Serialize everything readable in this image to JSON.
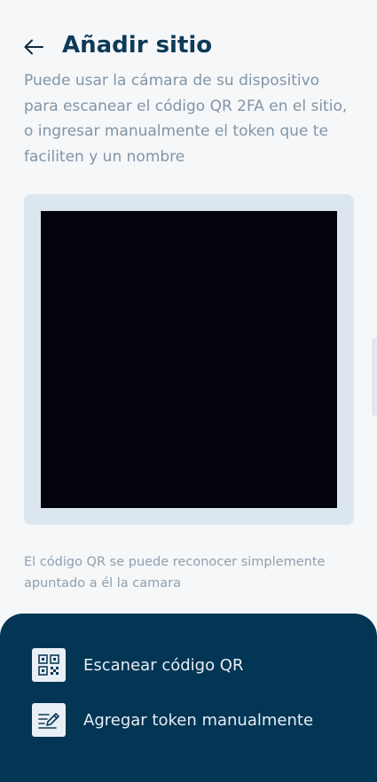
{
  "header": {
    "title": "Añadir sitio",
    "back_icon": "arrow-left-icon"
  },
  "intro_text": "Puede usar la cámara de su dispositivo para escanear el código QR 2FA en el sitio, o ingresar manualmente el token que te faciliten y un nombre",
  "hint_text": "El código QR se puede reconocer simplemente apuntado a él la camara",
  "actions": [
    {
      "label": "Escanear código QR",
      "icon": "qr-code-icon"
    },
    {
      "label": "Agregar token manualmente",
      "icon": "edit-note-icon"
    }
  ],
  "colors": {
    "title": "#0e3a58",
    "sheet_background": "#033554",
    "camera_frame": "#dce6ef",
    "camera_view": "#03040b"
  }
}
